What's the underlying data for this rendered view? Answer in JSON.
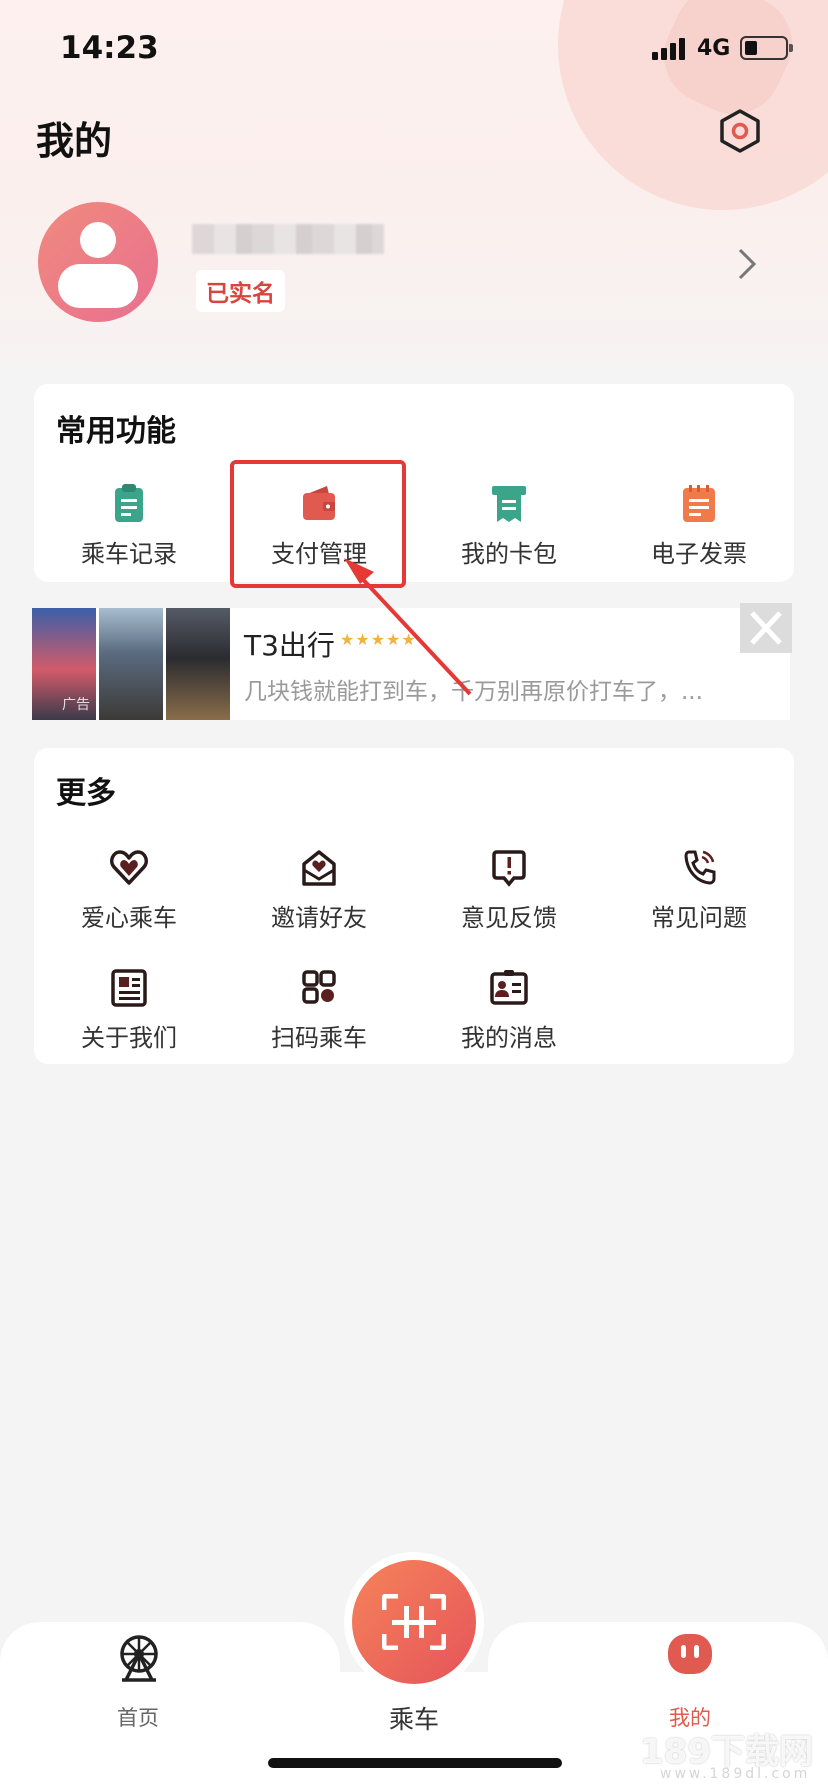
{
  "status_bar": {
    "time": "14:23",
    "network": "4G"
  },
  "header": {
    "title": "我的"
  },
  "profile": {
    "verified_label": "已实名"
  },
  "common_functions": {
    "title": "常用功能",
    "items": [
      {
        "label": "乘车记录",
        "icon": "clipboard-icon",
        "color": "#3aa58a"
      },
      {
        "label": "支付管理",
        "icon": "wallet-icon",
        "color": "#e05a4f"
      },
      {
        "label": "我的卡包",
        "icon": "card-pack-icon",
        "color": "#3aa58a"
      },
      {
        "label": "电子发票",
        "icon": "invoice-icon",
        "color": "#f07a4a"
      }
    ]
  },
  "ad": {
    "title": "T3出行",
    "stars": "★★★★★",
    "description": "几块钱就能打到车，千万别再原价打车了，...",
    "tag": "广告"
  },
  "more": {
    "title": "更多",
    "items": [
      {
        "label": "爱心乘车",
        "icon": "heart-icon"
      },
      {
        "label": "邀请好友",
        "icon": "invite-icon"
      },
      {
        "label": "意见反馈",
        "icon": "feedback-icon"
      },
      {
        "label": "常见问题",
        "icon": "phone-icon"
      },
      {
        "label": "关于我们",
        "icon": "about-icon"
      },
      {
        "label": "扫码乘车",
        "icon": "qr-icon"
      },
      {
        "label": "我的消息",
        "icon": "message-icon"
      }
    ]
  },
  "tabbar": {
    "home_label": "首页",
    "ride_label": "乘车",
    "mine_label": "我的"
  },
  "colors": {
    "accent": "#e05a4f",
    "teal": "#3aa58a",
    "highlight": "#e53935"
  },
  "watermark": {
    "text": "189下载网",
    "sub": "www.189dl.com"
  }
}
